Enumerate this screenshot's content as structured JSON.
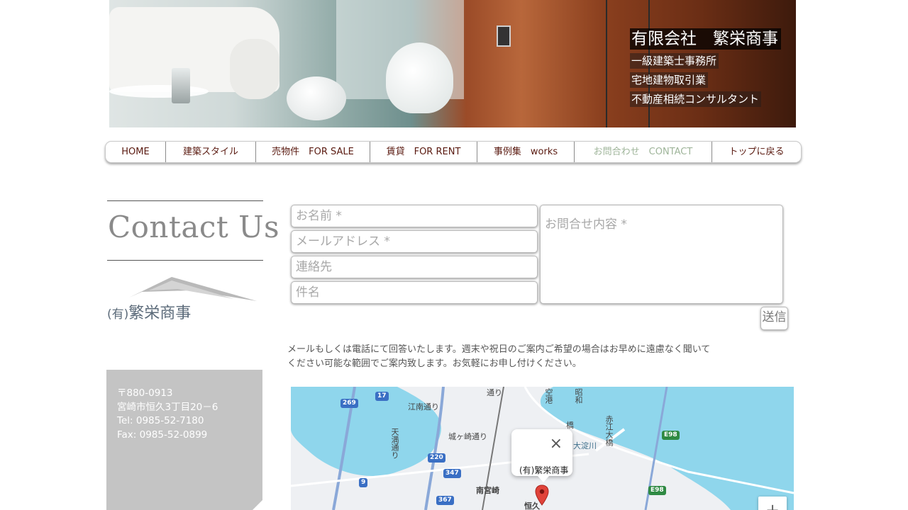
{
  "header": {
    "company_name": "有限会社　繁栄商事",
    "lines": [
      "一級建築士事務所",
      "宅地建物取引業",
      "不動産相続コンサルタント"
    ]
  },
  "nav": {
    "items": [
      {
        "label": "HOME",
        "active": false
      },
      {
        "label": "建築スタイル",
        "active": false
      },
      {
        "label": "売物件　FOR SALE",
        "active": false
      },
      {
        "label": "賃貸　FOR RENT",
        "active": false
      },
      {
        "label": "事例集　works",
        "active": false
      },
      {
        "label": "お問合わせ　CONTACT",
        "active": true
      },
      {
        "label": "トップに戻る",
        "active": false
      }
    ],
    "active_color": "#9fb59a",
    "text_color": "#5a1a10"
  },
  "left": {
    "title": "Contact Us",
    "logo_prefix": "(有)",
    "logo_name": "繁栄商事",
    "info": [
      "〒880-0913",
      "宮崎市恒久3丁目20－6",
      "Tel: 0985-52-7180",
      "Fax: 0985-52-0899"
    ]
  },
  "form": {
    "name_placeholder": "お名前 *",
    "email_placeholder": "メールアドレス *",
    "phone_placeholder": "連絡先",
    "subject_placeholder": "件名",
    "message_placeholder": "お問合せ内容 *",
    "submit_label": "送信"
  },
  "notice": "メールもしくは電話にて回答いたします。週末や祝日のご案内ご希望の場合はお早めに遠慮なく聞いてください可能な範囲でご案内致します。お気軽にお申し付けください。",
  "map": {
    "labels": {
      "street1": "江南通り",
      "street2": "城ヶ崎通り",
      "street3": "天満通り",
      "street4": "大淀川",
      "street5": "赤江大橋",
      "station": "南宮崎",
      "area": "恒久",
      "top1": "通り",
      "top2": "空港",
      "top3": "昭和",
      "bridge": "橋"
    },
    "shields": [
      "17",
      "269",
      "220",
      "347",
      "9",
      "367",
      "E98",
      "E98"
    ],
    "popup_text": "(有)繁栄商事",
    "close_icon": "×",
    "zoom_in": "+",
    "water_color": "#8fd6ec"
  }
}
